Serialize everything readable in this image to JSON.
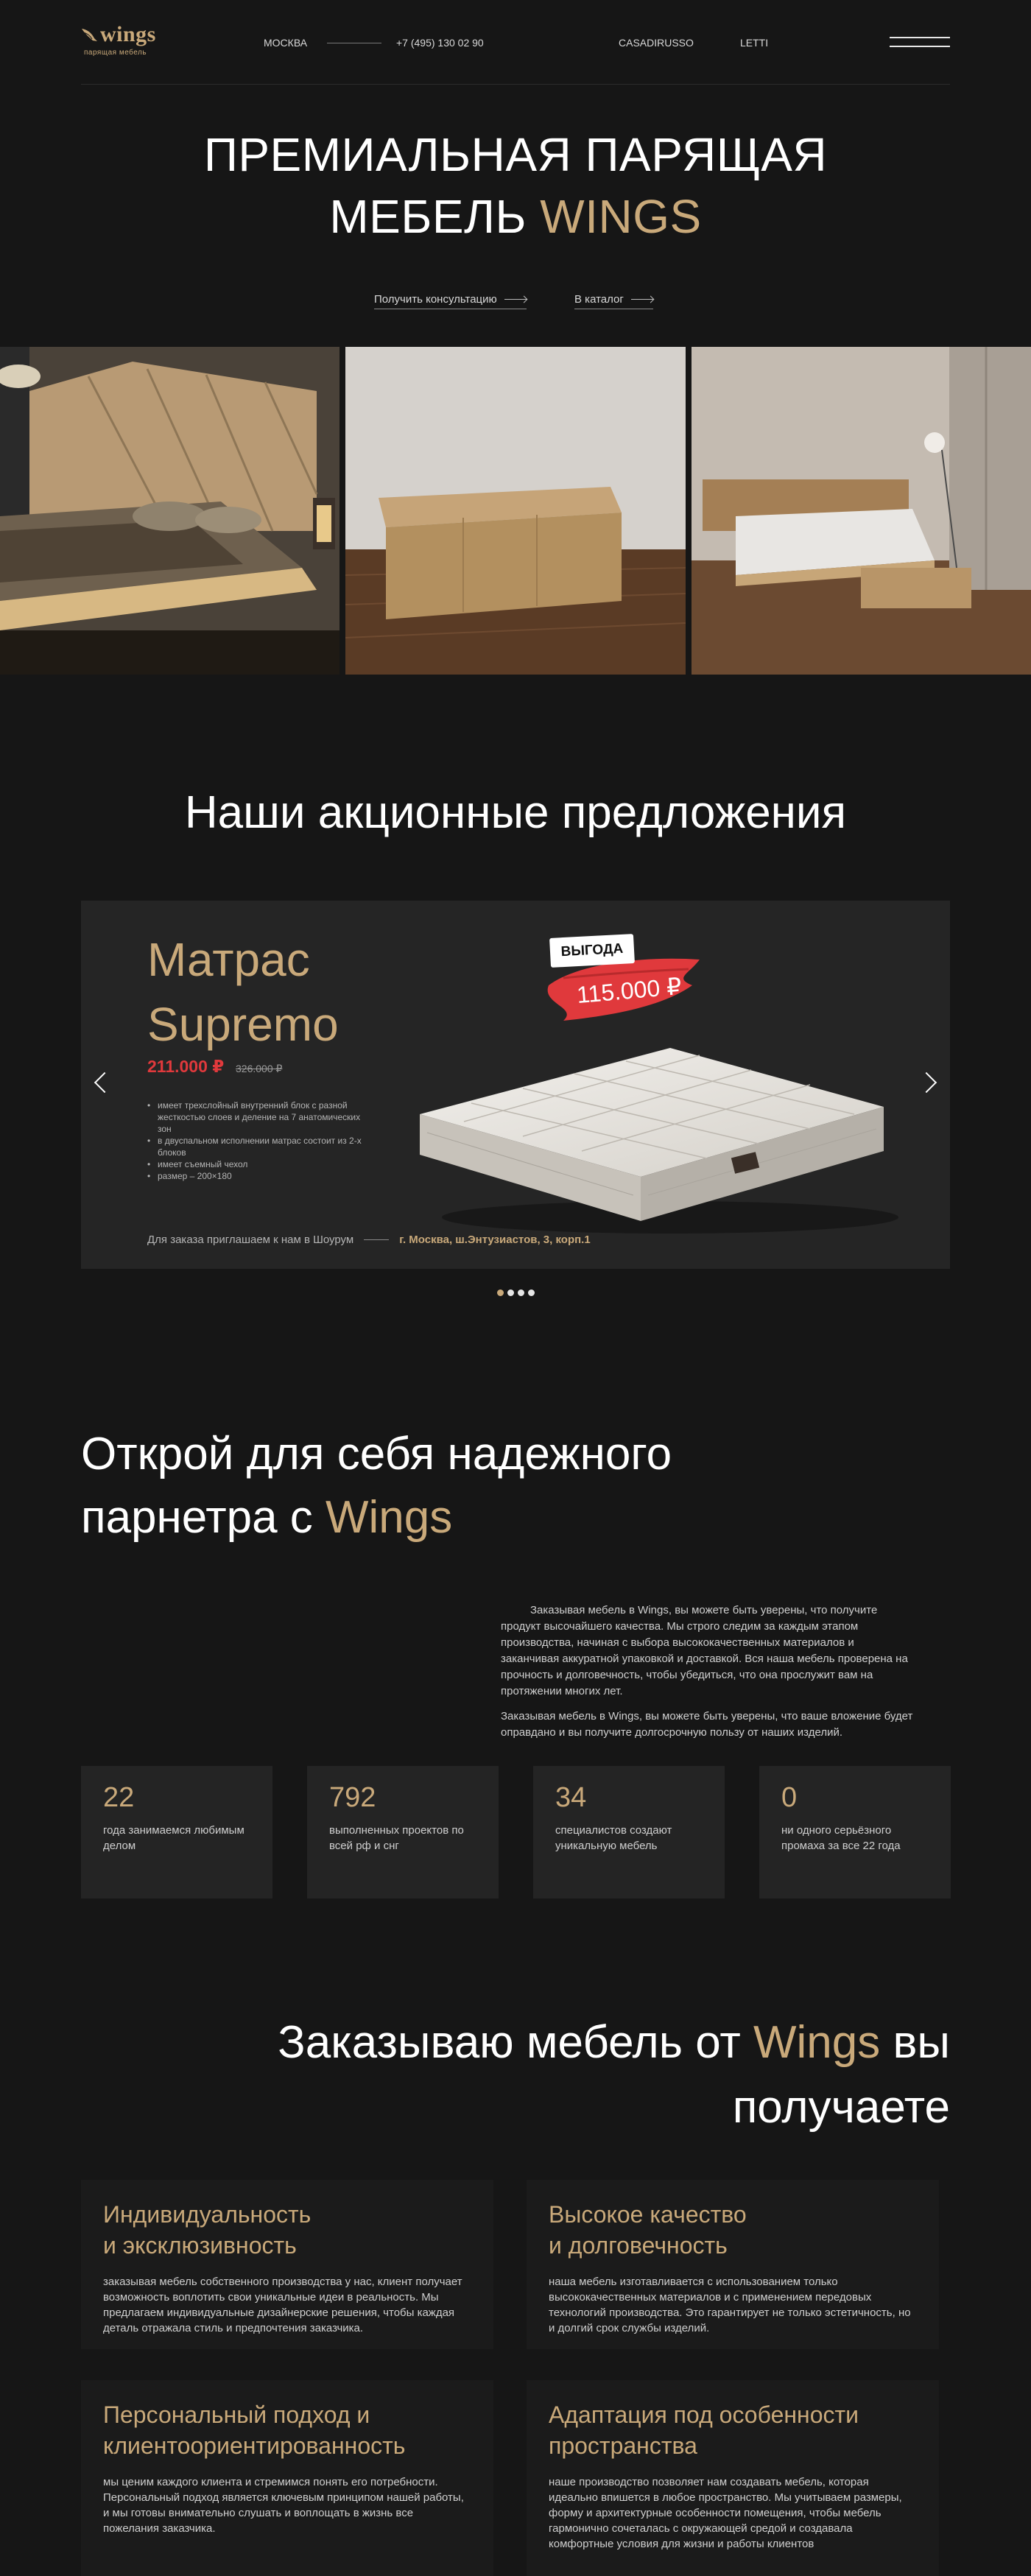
{
  "header": {
    "logo_word": "wings",
    "logo_sub": "парящая мебель",
    "city": "МОСКВА",
    "phone": "+7 (495) 130 02 90",
    "nav": [
      "CASADIRUSSO",
      "LETTI"
    ]
  },
  "hero": {
    "title_line1": "ПРЕМИАЛЬНАЯ ПАРЯЩАЯ",
    "title_line2_prefix": "МЕБЕЛЬ ",
    "title_line2_accent": "WINGS",
    "cta_consult": "Получить консультацию",
    "cta_catalog": "В каталог"
  },
  "promos": {
    "title": "Наши акционные предложения",
    "card": {
      "name_line1": "Матрас",
      "name_line2": "Supremo",
      "price": "211.000 ₽",
      "old_price": "326.000 ₽",
      "badge_label": "ВЫГОДА",
      "badge_price": "115.000 ₽",
      "features": [
        "имеет трехслойный внутренний блок с разной жесткостью слоев и деление на 7 анатомических зон",
        "в двуспальном исполнении матрас состоит из 2-х блоков",
        "имеет съемный чехол",
        "размер – 200×180"
      ],
      "footer_text": "Для заказа приглашаем к нам в Шоурум",
      "footer_address": "г. Москва, ш.Энтузиастов, 3, корп.1"
    },
    "slides_total": 4,
    "active_slide": 1
  },
  "partner": {
    "title_line1": "Открой для себя надежного",
    "title_line2_prefix": "парнетра с ",
    "title_line2_accent": "Wings",
    "paragraph1": "Заказывая мебель в Wings, вы можете быть уверены, что получите продукт высочайшего качества. Мы строго следим за каждым этапом производства, начиная с выбора высококачественных материалов и заканчивая аккуратной упаковкой и доставкой. Вся наша мебель проверена на прочность и долговечность, чтобы убедиться, что она прослужит вам на протяжении многих лет.",
    "paragraph2": "Заказывая мебель в Wings, вы можете быть уверены, что ваше вложение будет оправдано и вы получите долгосрочную пользу от наших изделий.",
    "stats": [
      {
        "value": "22",
        "label": "года занимаемся любимым делом"
      },
      {
        "value": "792",
        "label": "выполненных проектов по всей рф и снг"
      },
      {
        "value": "34",
        "label": "специалистов создают уникальную мебель"
      },
      {
        "value": "0",
        "label": "ни одного серьёзного промаха за все 22 года"
      }
    ]
  },
  "benefits": {
    "title_prefix": "Заказываю мебель от ",
    "title_accent": "Wings",
    "title_suffix_line1": " вы",
    "title_line2": "получаете",
    "cards": [
      {
        "head_line1": "Индивидуальность",
        "head_line2": "и эксклюзивность",
        "body": "заказывая мебель собственного производства у нас, клиент получает возможность воплотить свои уникальные идеи в реальность. Мы предлагаем индивидуальные дизайнерские решения, чтобы каждая деталь отражала стиль и предпочтения заказчика."
      },
      {
        "head_line1": "Высокое качество",
        "head_line2": "и долговечность",
        "body": "наша мебель изготавливается с использованием только высококачественных материалов и с применением передовых технологий производства. Это гарантирует не только эстетичность, но и долгий срок службы изделий."
      },
      {
        "head_line1": "Персональный подход и",
        "head_line2": "клиентоориентированность",
        "body": "мы ценим каждого клиента и стремимся понять его потребности. Персональный подход является ключевым принципом нашей работы, и мы готовы внимательно слушать и воплощать в жизнь все пожелания заказчика."
      },
      {
        "head_line1": "Адаптация под особенности",
        "head_line2": "пространства",
        "body": "наше производство позволяет нам создавать мебель, которая идеально впишется в любое пространство. Мы учитываем размеры, форму и архитектурные особенности помещения, чтобы мебель гармонично сочеталась с окружающей средой и создавала комфортные условия для жизни и работы клиентов"
      }
    ]
  },
  "colors": {
    "background": "#161616",
    "accent": "#c9a97a",
    "price_red": "#e0393c",
    "card": "#252525"
  }
}
